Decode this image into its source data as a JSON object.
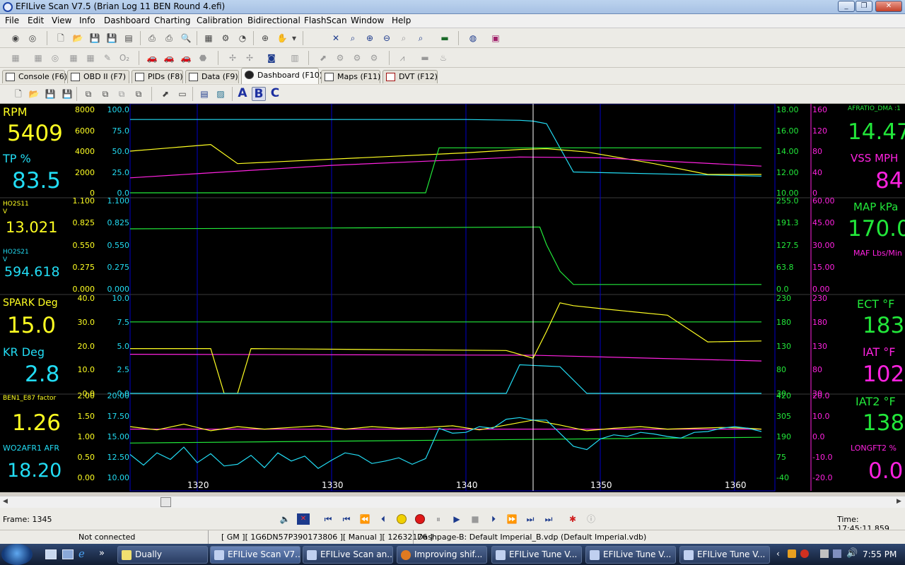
{
  "window": {
    "title": "EFILive Scan V7.5 (Brian Log 11 BEN Round 4.efi)",
    "minimize": "_",
    "restore": "❐",
    "close": "✕"
  },
  "menu": [
    "File",
    "Edit",
    "View",
    "Info",
    "Dashboard",
    "Charting",
    "Calibration",
    "Bidirectional",
    "FlashScan",
    "Window",
    "Help"
  ],
  "tabs": [
    {
      "label": "Console (F6)",
      "active": false
    },
    {
      "label": "OBD II (F7)",
      "active": false
    },
    {
      "label": "PIDs (F8)",
      "active": false
    },
    {
      "label": "Data (F9)",
      "active": false
    },
    {
      "label": "Dashboard (F10)",
      "active": true
    },
    {
      "label": "Maps (F11)",
      "active": false
    },
    {
      "label": "DVT (F12)",
      "active": false
    }
  ],
  "dash_buttons": {
    "a": "A",
    "b": "B",
    "c": "C"
  },
  "colors": {
    "yellow": "#ffff22",
    "cyan": "#22dcf4",
    "green": "#22e83a",
    "magenta": "#ff22e0",
    "bg": "#000000",
    "grid": "#0000c8"
  },
  "gauges": {
    "left": [
      {
        "name": "RPM",
        "value": "5409",
        "color": "#ffff22"
      },
      {
        "name": "TP %",
        "value": "83.5",
        "color": "#22dcf4"
      },
      {
        "name": "HO2S11",
        "unit": "V",
        "value": "13.021",
        "color": "#ffff22"
      },
      {
        "name": "HO2S21",
        "unit": "V",
        "value": "594.618",
        "color": "#22dcf4"
      },
      {
        "name": "SPARK Deg",
        "value": "15.0",
        "color": "#ffff22"
      },
      {
        "name": "KR Deg",
        "value": "2.8",
        "color": "#22dcf4"
      },
      {
        "name": "BEN1_E87 factor",
        "value": "1.26",
        "color": "#ffff22"
      },
      {
        "name": "WO2AFR1 AFR",
        "value": "18.20",
        "color": "#22dcf4"
      }
    ],
    "right": [
      {
        "name": "AFRATIO_DMA :1",
        "value": "14.47",
        "color": "#22e83a"
      },
      {
        "name": "VSS MPH",
        "value": "84",
        "color": "#ff22e0"
      },
      {
        "name": "MAP kPa",
        "value": "170.0",
        "color": "#22e83a"
      },
      {
        "name": "MAF Lbs/Min",
        "value": "",
        "color": "#ff22e0"
      },
      {
        "name": "ECT °F",
        "value": "183",
        "color": "#22e83a"
      },
      {
        "name": "IAT °F",
        "value": "102",
        "color": "#ff22e0"
      },
      {
        "name": "IAT2 °F",
        "value": "138",
        "color": "#22e83a"
      },
      {
        "name": "LONGFT2 %",
        "value": "0.0",
        "color": "#ff22e0"
      }
    ]
  },
  "chart_data": {
    "type": "line",
    "x_range": [
      1315,
      1363
    ],
    "cursor_frame": 1345,
    "x_ticks": [
      1320,
      1330,
      1340,
      1350,
      1360
    ],
    "panels": [
      {
        "left_scale_a": [
          "8000",
          "6000",
          "4000",
          "2000",
          "0"
        ],
        "left_scale_b": [
          "100.0",
          "75.0",
          "50.0",
          "25.0",
          "0.0"
        ],
        "right_scale_a": [
          "18.00",
          "16.00",
          "14.00",
          "12.00",
          "10.00"
        ],
        "right_scale_b": [
          "160",
          "120",
          "80",
          "40",
          "0"
        ],
        "series": [
          {
            "color": "#22dcf4",
            "x": [
              1315,
              1340,
              1344,
              1345,
              1346,
              1348,
              1362
            ],
            "y": [
              88,
              88,
              87,
              86,
              83,
              25,
              20
            ]
          },
          {
            "color": "#ffff22",
            "x": [
              1315,
              1318,
              1321,
              1323,
              1340,
              1344,
              1346,
              1349,
              1354,
              1358,
              1362
            ],
            "y": [
              50,
              54,
              58,
              35,
              48,
              52,
              53,
              49,
              35,
              22,
              22
            ]
          },
          {
            "color": "#ff22e0",
            "x": [
              1315,
              1320,
              1330,
              1340,
              1344,
              1350,
              1362
            ],
            "y": [
              18,
              23,
              33,
              40,
              43,
              42,
              32
            ]
          },
          {
            "color": "#22e83a",
            "x": [
              1315,
              1337,
              1338,
              1362
            ],
            "y": [
              0,
              0,
              54,
              54
            ]
          }
        ]
      },
      {
        "left_scale_a": [
          "1.100",
          "0.825",
          "0.550",
          "0.275",
          "0.000"
        ],
        "left_scale_b": [
          "1.100",
          "0.825",
          "0.550",
          "0.275",
          "0.000"
        ],
        "right_scale_a": [
          "255.0",
          "191.3",
          "127.5",
          "63.8",
          "0.0"
        ],
        "right_scale_b": [
          "60.00",
          "45.00",
          "30.00",
          "15.00",
          "0.00"
        ],
        "series": [
          {
            "color": "#22e83a",
            "x": [
              1315,
              1330,
              1345,
              1345.5,
              1346,
              1347,
              1348,
              1362
            ],
            "y": [
              68,
              69,
              70,
              70,
              50,
              20,
              5,
              5
            ]
          }
        ]
      },
      {
        "left_scale_a": [
          "40.0",
          "30.0",
          "20.0",
          "10.0",
          "0.0"
        ],
        "left_scale_b": [
          "10.0",
          "7.5",
          "5.0",
          "2.5",
          "0.0"
        ],
        "right_scale_a": [
          "230",
          "180",
          "130",
          "80",
          "30"
        ],
        "right_scale_b": [
          "230",
          "180",
          "130",
          "80",
          "30"
        ],
        "series": [
          {
            "color": "#22e83a",
            "x": [
              1315,
              1362
            ],
            "y": [
              75,
              75
            ]
          },
          {
            "color": "#ff22e0",
            "x": [
              1315,
              1345,
              1362
            ],
            "y": [
              41,
              40,
              34
            ]
          },
          {
            "color": "#ffff22",
            "x": [
              1315,
              1321,
              1322,
              1323,
              1324,
              1343,
              1345,
              1346,
              1347,
              1348,
              1350,
              1355,
              1358,
              1362
            ],
            "y": [
              47,
              47,
              0,
              0,
              47,
              45,
              37,
              65,
              95,
              92,
              89,
              82,
              54,
              55
            ]
          },
          {
            "color": "#22dcf4",
            "x": [
              1315,
              1343,
              1344,
              1347,
              1349,
              1362
            ],
            "y": [
              0,
              0,
              30,
              28,
              0,
              0
            ]
          }
        ]
      },
      {
        "left_scale_a": [
          "2.00",
          "1.50",
          "1.00",
          "0.50",
          "0.00"
        ],
        "left_scale_b": [
          "20.00",
          "17.50",
          "15.00",
          "12.50",
          "10.00"
        ],
        "right_scale_a": [
          "420",
          "305",
          "190",
          "75",
          "-40"
        ],
        "right_scale_b": [
          "20.0",
          "10.0",
          "0.0",
          "-10.0",
          "-20.0"
        ],
        "series": [
          {
            "color": "#ff22e0",
            "x": [
              1315,
              1362
            ],
            "y": [
              59,
              59
            ]
          },
          {
            "color": "#22e83a",
            "x": [
              1315,
              1362
            ],
            "y": [
              42,
              49
            ]
          },
          {
            "color": "#ffff22",
            "x": [
              1315,
              1317,
              1319,
              1321,
              1323,
              1325,
              1327,
              1329,
              1331,
              1333,
              1335,
              1337,
              1339,
              1341,
              1343,
              1345,
              1347,
              1349,
              1351,
              1353,
              1355,
              1357,
              1359,
              1361,
              1362
            ],
            "y": [
              62,
              58,
              65,
              57,
              62,
              59,
              61,
              63,
              59,
              62,
              60,
              61,
              63,
              58,
              64,
              70,
              64,
              57,
              60,
              62,
              59,
              60,
              61,
              60,
              59
            ]
          },
          {
            "color": "#22dcf4",
            "x": [
              1315,
              1316,
              1317,
              1318,
              1319,
              1320,
              1321,
              1322,
              1323,
              1324,
              1325,
              1326,
              1327,
              1328,
              1329,
              1330,
              1331,
              1332,
              1333,
              1334,
              1335,
              1336,
              1337,
              1338,
              1339,
              1340,
              1341,
              1342,
              1343,
              1344,
              1345,
              1346,
              1347,
              1348,
              1349,
              1350,
              1351,
              1352,
              1353,
              1354,
              1355,
              1356,
              1357,
              1358,
              1359,
              1360,
              1361,
              1362
            ],
            "y": [
              28,
              15,
              30,
              22,
              37,
              18,
              29,
              14,
              16,
              27,
              12,
              30,
              20,
              26,
              11,
              21,
              30,
              27,
              17,
              20,
              24,
              16,
              23,
              60,
              54,
              55,
              62,
              60,
              71,
              73,
              70,
              70,
              54,
              38,
              34,
              47,
              52,
              50,
              55,
              53,
              50,
              48,
              55,
              56,
              60,
              62,
              60,
              56
            ]
          }
        ]
      }
    ]
  },
  "controls": {
    "frame_label": "Frame: 1345",
    "time_label": "Time: 17:45:11.859"
  },
  "status": {
    "connection": "Not connected",
    "vehicle": "[ GM ][ 1G6DN57P390173806 ][ Manual ][ 12632176 ]",
    "dashpage": "Dashpage-B: Default Imperial_B.vdp (Default Imperial.vdb)"
  },
  "taskbar": {
    "items": [
      {
        "label": "Dually",
        "active": false
      },
      {
        "label": "EFILive Scan V7...",
        "active": true
      },
      {
        "label": "EFILive Scan an...",
        "active": false
      },
      {
        "label": "Improving shif...",
        "active": false
      },
      {
        "label": "EFILive Tune V...",
        "active": false
      },
      {
        "label": "EFILive Tune V...",
        "active": false
      },
      {
        "label": "EFILive Tune V...",
        "active": false
      }
    ],
    "clock": "7:55 PM"
  }
}
